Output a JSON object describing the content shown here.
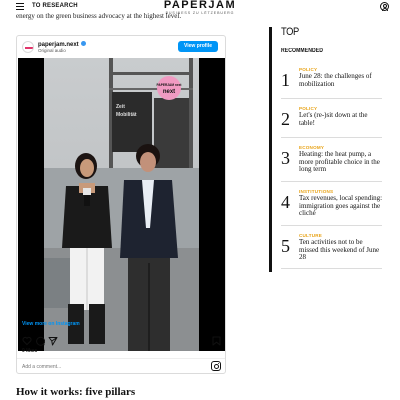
{
  "header": {
    "nav_label": "TO RESEARCH",
    "logo_main": "PAPERJAM",
    "logo_sub": "BUSINESS ZU LËTZEBUERG",
    "cut_text": "energy on the green business advocacy at the highest level."
  },
  "embed": {
    "username": "paperjam.next",
    "audio": "Original audio",
    "view_profile_label": "View profile",
    "badge_text": "PAPERJAM next",
    "view_more_label": "View more on Instagram",
    "likes": "9 likes",
    "add_comment_placeholder": "Add a comment...",
    "accent_color": "#0095f6"
  },
  "article": {
    "section_heading": "How it works: five pillars"
  },
  "sidebar": {
    "title": "TOP",
    "subtitle": "RECOMMENDED",
    "category_color": "#e8a317",
    "items": [
      {
        "num": "1",
        "category": "POLICY",
        "title": "June 28: the challenges of mobilization"
      },
      {
        "num": "2",
        "category": "POLICY",
        "title": "Let's (re-)sit down at the table!"
      },
      {
        "num": "3",
        "category": "ECONOMY",
        "title": "Heating: the heat pump, a more profitable choice in the long term"
      },
      {
        "num": "4",
        "category": "INSTITUTIONS",
        "title": "Tax revenues, local spending: immigration goes against the cliché"
      },
      {
        "num": "5",
        "category": "CULTURE",
        "title": "Ten activities not to be missed this weekend of June 28"
      }
    ]
  }
}
